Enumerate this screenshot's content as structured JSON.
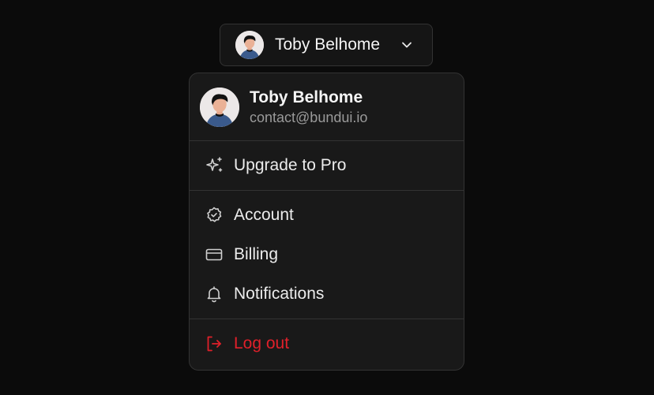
{
  "trigger": {
    "name": "Toby Belhome"
  },
  "menu": {
    "profile": {
      "name": "Toby Belhome",
      "email": "contact@bundui.io"
    },
    "sections": [
      [
        {
          "label": "Upgrade to Pro",
          "icon": "sparkles-icon"
        }
      ],
      [
        {
          "label": "Account",
          "icon": "badge-check-icon"
        },
        {
          "label": "Billing",
          "icon": "credit-card-icon"
        },
        {
          "label": "Notifications",
          "icon": "bell-icon"
        }
      ],
      [
        {
          "label": "Log out",
          "icon": "log-out-icon",
          "danger": true
        }
      ]
    ]
  },
  "colors": {
    "background": "#0b0b0b",
    "menu_surface": "#191919",
    "border": "#333333",
    "danger": "#e0202a"
  }
}
